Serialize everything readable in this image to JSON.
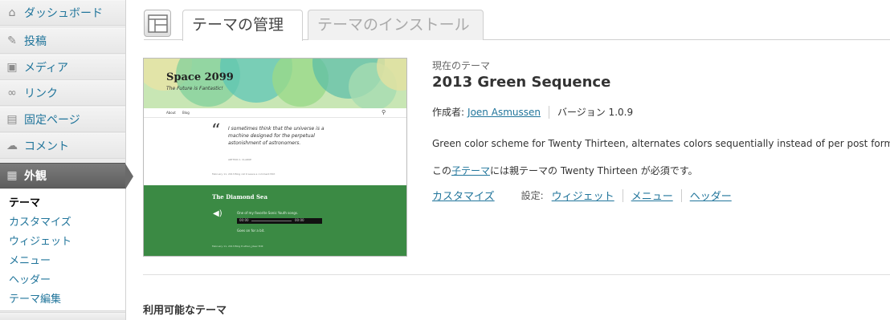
{
  "sidebar": {
    "items": [
      {
        "label": "ダッシュボード",
        "icon": "dashboard-icon",
        "glyph": "⌂"
      },
      {
        "label": "投稿",
        "icon": "pin-icon",
        "glyph": "✎"
      },
      {
        "label": "メディア",
        "icon": "media-icon",
        "glyph": "▣"
      },
      {
        "label": "リンク",
        "icon": "link-icon",
        "glyph": "∞"
      },
      {
        "label": "固定ページ",
        "icon": "pages-icon",
        "glyph": "▤"
      },
      {
        "label": "コメント",
        "icon": "comment-icon",
        "glyph": "☁"
      },
      {
        "label": "外観",
        "icon": "appearance-icon",
        "glyph": "▦"
      }
    ],
    "submenu": [
      "テーマ",
      "カスタマイズ",
      "ウィジェット",
      "メニュー",
      "ヘッダー",
      "テーマ編集"
    ]
  },
  "tabs": {
    "manage": "テーマの管理",
    "install": "テーマのインストール"
  },
  "theme_preview": {
    "site_title": "Space 2099",
    "tagline": "The Future is Fantastic!",
    "nav": [
      "About",
      "Blog"
    ],
    "quote": "I sometimes think that the universe is a machine designed for the perpetual astonishment of astronomers.",
    "quote_author": "ARTHUR C. CLARKE",
    "meta": "February 11, 2013   Blog   cat 9   Leave a comment   Edit",
    "post_title": "The Diamond Sea",
    "post_sub": "One of my favorite Sonic Youth songs.",
    "player_time_left": "00:00",
    "player_time_right": "00:00",
    "post_end": "Goes on for a bit.",
    "post_meta": "February 11, 2013   Blog   8 ethan_jdeer   Edit"
  },
  "current_theme": {
    "label": "現在のテーマ",
    "name": "2013 Green Sequence",
    "author_prefix": "作成者:",
    "author": "Joen Asmussen",
    "version": "バージョン 1.0.9",
    "description": "Green color scheme for Twenty Thirteen, alternates colors sequentially instead of per post formats.",
    "parent_pre": "この",
    "parent_link": "子テーマ",
    "parent_post": "には親テーマの Twenty Thirteen が必須です。",
    "customize": "カスタマイズ",
    "settings_label": "設定:",
    "settings_links": [
      "ウィジェット",
      "メニュー",
      "ヘッダー"
    ]
  },
  "available_heading": "利用可能なテーマ",
  "colors": {
    "link": "#21759b",
    "menu_active": "#6a6a6a",
    "theme_green": "#3b8a44"
  }
}
